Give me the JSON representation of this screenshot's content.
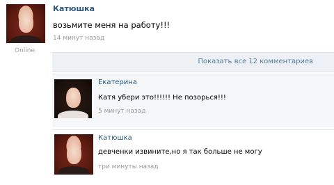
{
  "post": {
    "author": "Катюшка",
    "text": "возьмите меня на работу!!!",
    "time": "14 минут назад",
    "status": "Online"
  },
  "comments_toggle": {
    "label": "Показать все 12 комментариев"
  },
  "comments": [
    {
      "author": "Екатерина",
      "text": "Катя убери это!!!!!! Не позорься!!!",
      "time": "5 минут назад"
    },
    {
      "author": "Катюшка",
      "text": "девченки извините,но я так больше не могу",
      "time": "три минуты назад"
    }
  ],
  "colors": {
    "link": "#2b587a",
    "muted": "#9a9a9a",
    "comments_bg": "#edf1f5"
  }
}
